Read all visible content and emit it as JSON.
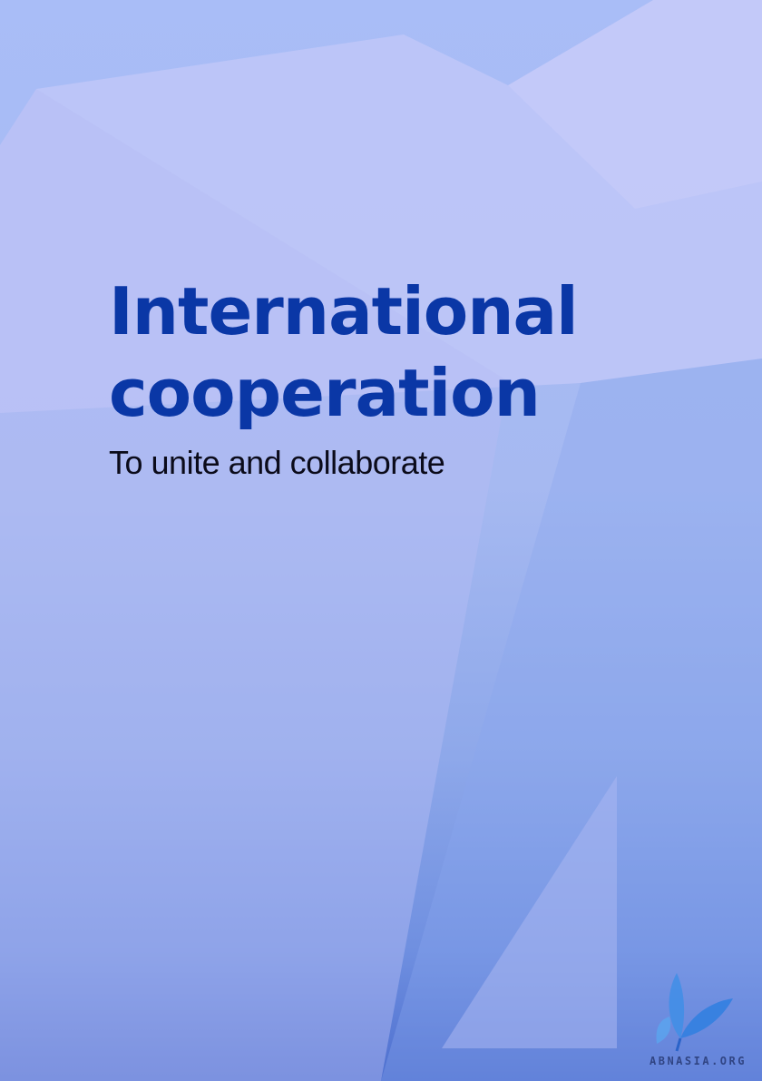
{
  "page": {
    "title_line1": "International",
    "title_line2": "cooperation",
    "subtitle": "To unite and collaborate"
  },
  "watermark": {
    "text": "ABNASIA.ORG",
    "icon": "leaf-logo-icon"
  },
  "colors": {
    "title": "#0a37a6",
    "subtitle": "#0b0b1a",
    "background_top": "#a9bdf7",
    "background_bottom": "#4d6fcf"
  }
}
